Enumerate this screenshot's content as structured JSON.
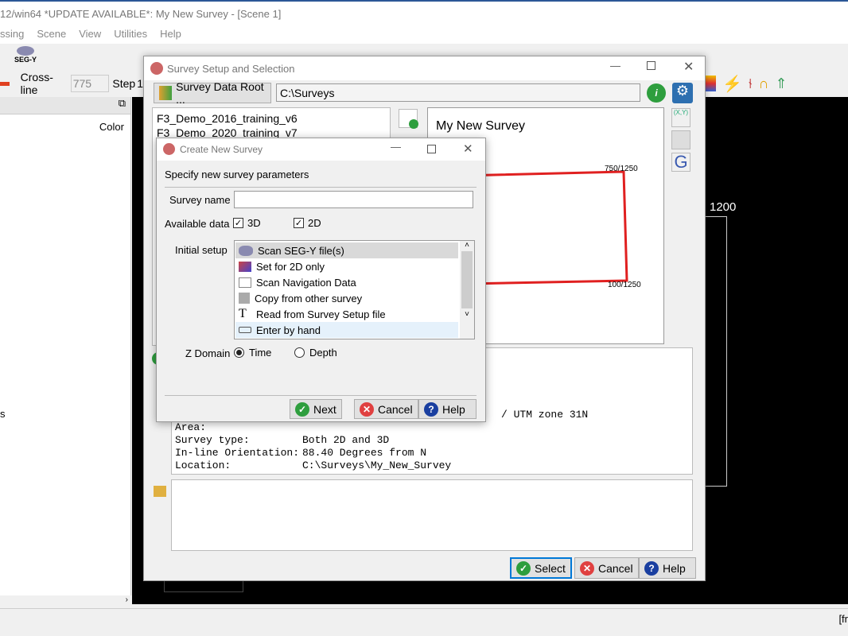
{
  "main": {
    "title": "12/win64 *UPDATE AVAILABLE*: My New Survey - [Scene 1]",
    "menu": [
      "ssing",
      "Scene",
      "View",
      "Utilities",
      "Help"
    ],
    "segy_label": "SEG-Y",
    "crossline_label": "Cross-line",
    "crossline_value": "775",
    "step_label": "Step",
    "step_value": "1",
    "tree_color_header": "Color",
    "left_text": "s",
    "scene_label": "1200",
    "status_right": "[fr"
  },
  "setup": {
    "title": "Survey Setup and Selection",
    "root_button": "Survey Data Root ...",
    "root_path": "C:\\Surveys",
    "surveys": [
      "F3_Demo_2016_training_v6",
      "F3_Demo_2020_training_v7"
    ],
    "map_title": "My New Survey",
    "corner_top": "750/1250",
    "corner_bottom": "100/1250",
    "info": [
      {
        "k": "",
        "v": "/ UTM zone 31N"
      },
      {
        "k": "Area:",
        "v": ""
      },
      {
        "k": "Survey type:",
        "v": "Both 2D and 3D"
      },
      {
        "k": "In-line Orientation:",
        "v": "88.40 Degrees from N"
      },
      {
        "k": "Location:",
        "v": "C:\\Surveys\\My_New_Survey"
      }
    ],
    "select": "Select",
    "cancel": "Cancel",
    "help": "Help"
  },
  "create": {
    "title": "Create New Survey",
    "heading": "Specify new survey parameters",
    "name_label": "Survey name",
    "name_value": "",
    "avail_label": "Available data",
    "opt3d": "3D",
    "opt2d": "2D",
    "checked3d": true,
    "checked2d": true,
    "setup_label": "Initial setup",
    "setup_options": [
      "Scan SEG-Y file(s)",
      "Set for 2D only",
      "Scan Navigation Data",
      "Copy from other survey",
      "Read from Survey Setup file",
      "Enter by hand"
    ],
    "selected_option": "Scan SEG-Y file(s)",
    "zdomain_label": "Z Domain",
    "time": "Time",
    "depth": "Depth",
    "zdomain_value": "Time",
    "next": "Next",
    "cancel": "Cancel",
    "help": "Help"
  },
  "colors": {
    "accent": "#0078d7",
    "red": "#e02020",
    "green": "#2e9e3e"
  }
}
